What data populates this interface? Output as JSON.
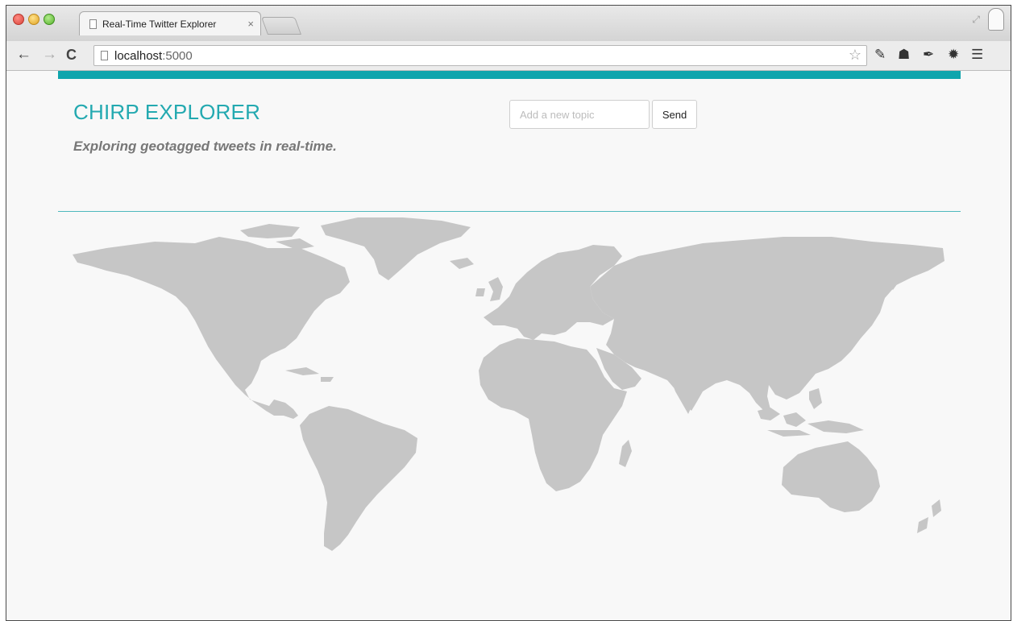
{
  "browser": {
    "tab_title": "Real-Time Twitter Explorer",
    "tab_close": "×",
    "url_host": "localhost",
    "url_port": ":5000",
    "icons": [
      "back-arrow-icon",
      "forward-arrow-icon",
      "reload-icon",
      "page-icon",
      "bookmark-star-icon",
      "wrench-icon",
      "incognito-icon",
      "pin-icon",
      "gear-icon",
      "menu-icon",
      "profile-icon",
      "resize-icon"
    ]
  },
  "app": {
    "brand": "CHIRP EXPLORER",
    "tagline": "Exploring geotagged tweets in real-time.",
    "topic_placeholder": "Add a new topic",
    "send_label": "Send",
    "accent_color": "#0fa5ad",
    "land_color": "#c6c6c6"
  }
}
